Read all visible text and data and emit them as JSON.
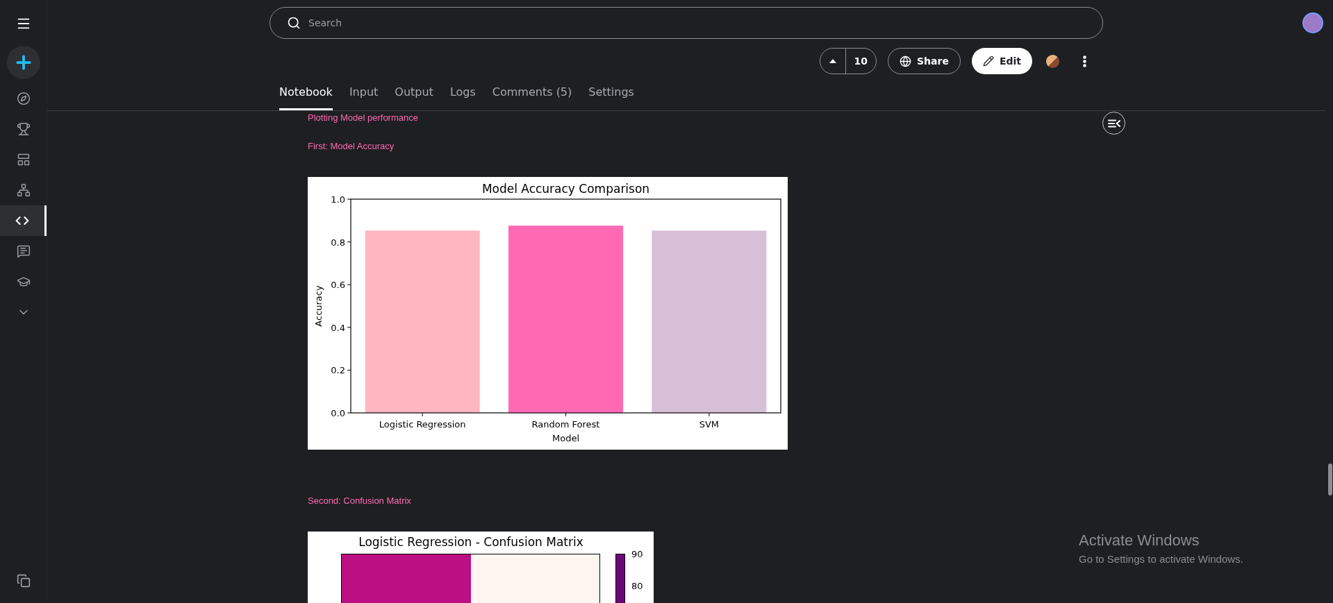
{
  "sidebar": {
    "items": [
      {
        "kind": "compass",
        "selected": false
      },
      {
        "kind": "trophy",
        "selected": false
      },
      {
        "kind": "table",
        "selected": false
      },
      {
        "kind": "network",
        "selected": false
      },
      {
        "kind": "code",
        "selected": true
      },
      {
        "kind": "comments",
        "selected": false
      },
      {
        "kind": "learn",
        "selected": false
      },
      {
        "kind": "more",
        "selected": false
      }
    ]
  },
  "search": {
    "placeholder": "Search"
  },
  "toolbar": {
    "vote_count": "10",
    "share_label": "Share",
    "edit_label": "Edit"
  },
  "tabs": [
    {
      "label": "Notebook",
      "selected": true
    },
    {
      "label": "Input",
      "selected": false
    },
    {
      "label": "Output",
      "selected": false
    },
    {
      "label": "Logs",
      "selected": false
    },
    {
      "label": "Comments (5)",
      "selected": false
    },
    {
      "label": "Settings",
      "selected": false
    }
  ],
  "notebook": {
    "section_heading": "Plotting Model performance",
    "cells": [
      {
        "kind": "text",
        "text": "First: Model Accuracy"
      },
      {
        "kind": "bar_chart",
        "chart_data": {
          "type": "bar",
          "title": "Model Accuracy Comparison",
          "xlabel": "Model",
          "ylabel": "Accuracy",
          "categories": [
            "Logistic Regression",
            "Random Forest",
            "SVM"
          ],
          "series": [
            {
              "color": "#ffb6c1",
              "values": [
                0.853,
                null,
                null
              ]
            },
            {
              "color": "#ff69b4",
              "values": [
                null,
                0.876,
                null
              ]
            },
            {
              "color": "#d8bfd8",
              "values": [
                null,
                null,
                0.853
              ]
            }
          ],
          "ylim": [
            0,
            1
          ],
          "yticks": [
            {
              "value": 0,
              "label": "0.0"
            },
            {
              "value": 0.2,
              "label": "0.2"
            },
            {
              "value": 0.4,
              "label": "0.4"
            },
            {
              "value": 0.6,
              "label": "0.6"
            },
            {
              "value": 0.8,
              "label": "0.8"
            },
            {
              "value": 1,
              "label": "1.0"
            }
          ]
        }
      },
      {
        "kind": "text",
        "text": "Second: Confusion Matrix"
      },
      {
        "kind": "heatmap",
        "title": "Logistic Regression - Confusion Matrix",
        "colorbar_ticks": [
          "90",
          "80"
        ]
      }
    ]
  },
  "os_notice": {
    "title": "Activate Windows",
    "message": "Go to Settings to activate Windows."
  }
}
